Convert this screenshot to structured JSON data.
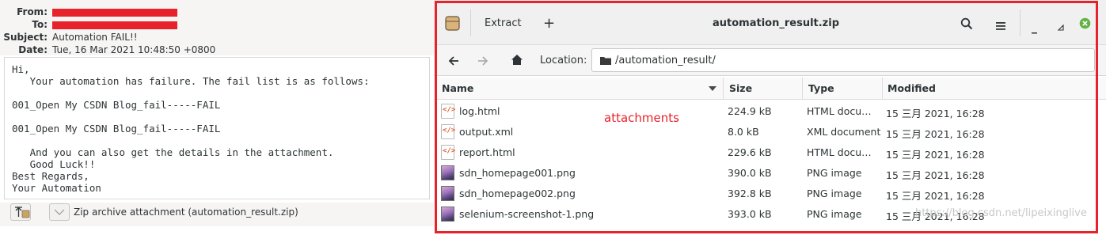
{
  "email": {
    "headers": {
      "from_label": "From:",
      "to_label": "To:",
      "subject_label": "Subject:",
      "subject": "Automation FAIL!!",
      "date_label": "Date:",
      "date": "Tue, 16 Mar 2021 10:48:50 +0800"
    },
    "body_lines": [
      "Hi,",
      "   Your automation has failure. The fail list is as follows:",
      "",
      "001_Open My CSDN Blog_fail-----FAIL",
      "",
      "001_Open My CSDN Blog_fail-----FAIL",
      "",
      "   And you can also get the details in the attachment.",
      "   Good Luck!!",
      "Best Regards,",
      "Your Automation"
    ],
    "attachment_text": "Zip archive attachment (automation_result.zip)"
  },
  "archive": {
    "extract_label": "Extract",
    "add_label": "+",
    "title": "automation_result.zip",
    "location_label": "Location:",
    "location_value": "/automation_result/",
    "columns": {
      "name": "Name",
      "size": "Size",
      "type": "Type",
      "modified": "Modified"
    },
    "files": [
      {
        "name": "log.html",
        "size": "224.9 kB",
        "type": "HTML docu…",
        "modified": "15 三月 2021, 16:28",
        "icon": "html-file-icon"
      },
      {
        "name": "output.xml",
        "size": "8.0 kB",
        "type": "XML document",
        "modified": "15 三月 2021, 16:28",
        "icon": "xml-file-icon"
      },
      {
        "name": "report.html",
        "size": "229.6 kB",
        "type": "HTML docu…",
        "modified": "15 三月 2021, 16:28",
        "icon": "html-file-icon"
      },
      {
        "name": "sdn_homepage001.png",
        "size": "390.0 kB",
        "type": "PNG image",
        "modified": "15 三月 2021, 16:28",
        "icon": "png-file-icon"
      },
      {
        "name": "sdn_homepage002.png",
        "size": "392.8 kB",
        "type": "PNG image",
        "modified": "15 三月 2021, 16:28",
        "icon": "png-file-icon"
      },
      {
        "name": "selenium-screenshot-1.png",
        "size": "393.0 kB",
        "type": "PNG image",
        "modified": "15 三月 2021, 16:28",
        "icon": "png-file-icon"
      }
    ]
  },
  "annotation": "attachments",
  "watermark": "https://blog.csdn.net/lipeixinglive",
  "colors": {
    "annotation_red": "#e8222a",
    "close_button_green": "#62b246"
  }
}
